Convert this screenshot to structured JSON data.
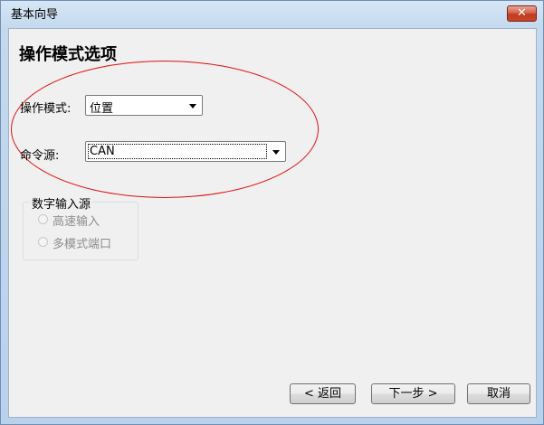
{
  "window": {
    "title": "基本向导",
    "close_label": "✕"
  },
  "page": {
    "heading": "操作模式选项"
  },
  "operation_mode": {
    "label": "操作模式:",
    "value": "位置"
  },
  "command_source": {
    "label": "命令源:",
    "value": "CAN"
  },
  "digital_input_source": {
    "legend": "数字输入源",
    "options": [
      "高速输入",
      "多模式端口"
    ]
  },
  "buttons": {
    "back": "< 返回",
    "next": "下一步 >",
    "cancel": "取消"
  },
  "colors": {
    "annotation_ellipse": "#e01010",
    "close_button": "#c9462a"
  }
}
